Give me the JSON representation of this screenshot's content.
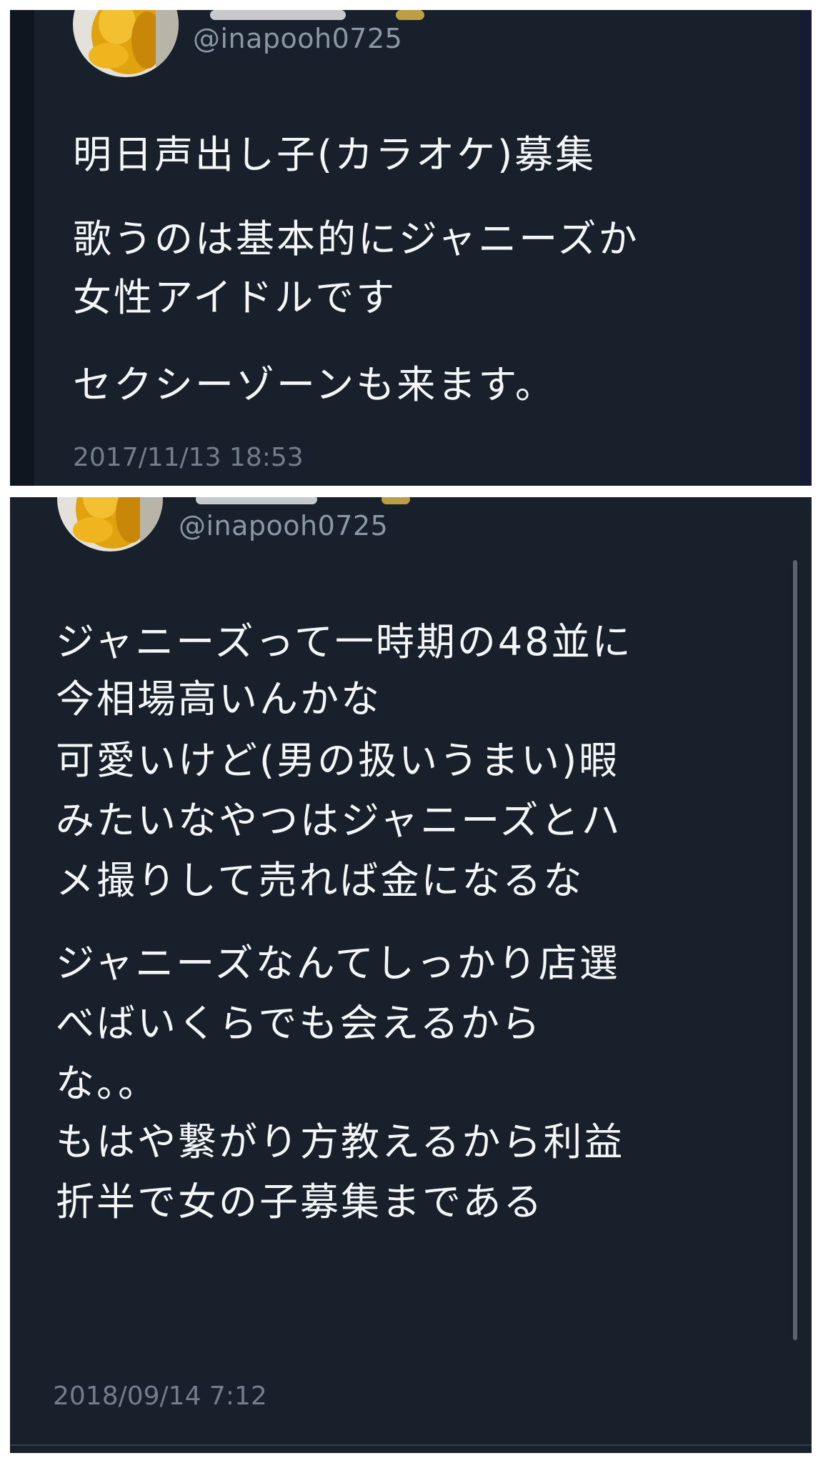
{
  "tweets": [
    {
      "handle": "@inapooh0725",
      "lines": [
        "明日声出し子(カラオケ)募集",
        "歌うのは基本的にジャニーズか",
        "女性アイドルです",
        "セクシーゾーンも来ます。"
      ],
      "timestamp": "2017/11/13 18:53"
    },
    {
      "handle": "@inapooh0725",
      "lines": [
        "ジャニーズって一時期の48並に",
        "今相場高いんかな",
        "可愛いけど(男の扱いうまい)暇",
        "みたいなやつはジャニーズとハ",
        "メ撮りして売れば金になるな",
        "ジャニーズなんてしっかり店選",
        "べばいくらでも会えるから",
        "な。。",
        "もはや繋がり方教えるから利益",
        "折半で女の子募集まである"
      ],
      "timestamp": "2018/09/14 7:12"
    }
  ],
  "colors": {
    "panel_background": "#17202b",
    "body_text": "#f4f6f8",
    "handle_text": "#8a98a6",
    "timestamp_text": "#727e8a",
    "separator": "#ffffff"
  },
  "icons": {
    "avatar": "yellow-plush-bear-avatar"
  }
}
